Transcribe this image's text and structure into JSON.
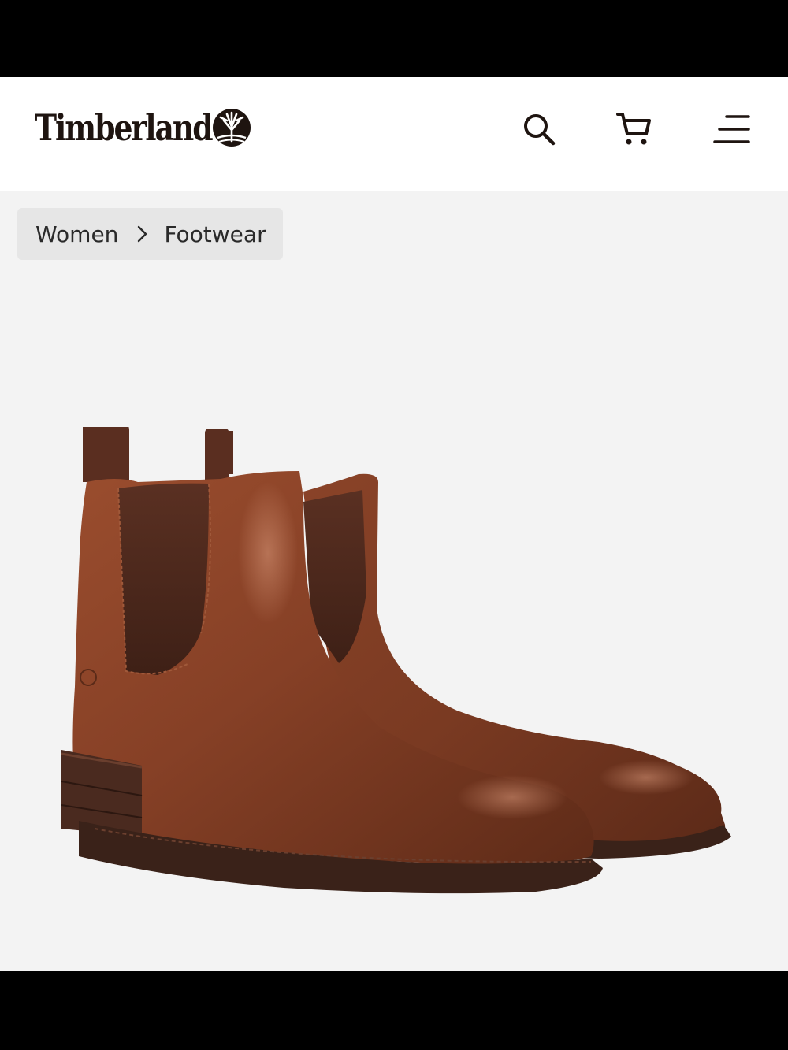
{
  "brand": {
    "name": "Timberland"
  },
  "header": {
    "icons": {
      "search": "search-icon",
      "cart": "cart-icon",
      "menu": "menu-icon"
    }
  },
  "breadcrumb": {
    "items": [
      {
        "label": "Women"
      },
      {
        "label": "Footwear"
      }
    ],
    "separator_icon": "chevron-right-icon"
  },
  "product": {
    "image_icon": "chelsea-boots-image",
    "colors": {
      "leather": "#7a3a22",
      "elastic": "#4f2a1c",
      "sole": "#3a2219",
      "background": "#f3f3f3"
    }
  },
  "colors": {
    "header_bg": "#ffffff",
    "text": "#1e1410",
    "breadcrumb_bg": "#e6e6e6",
    "frame": "#000000"
  }
}
